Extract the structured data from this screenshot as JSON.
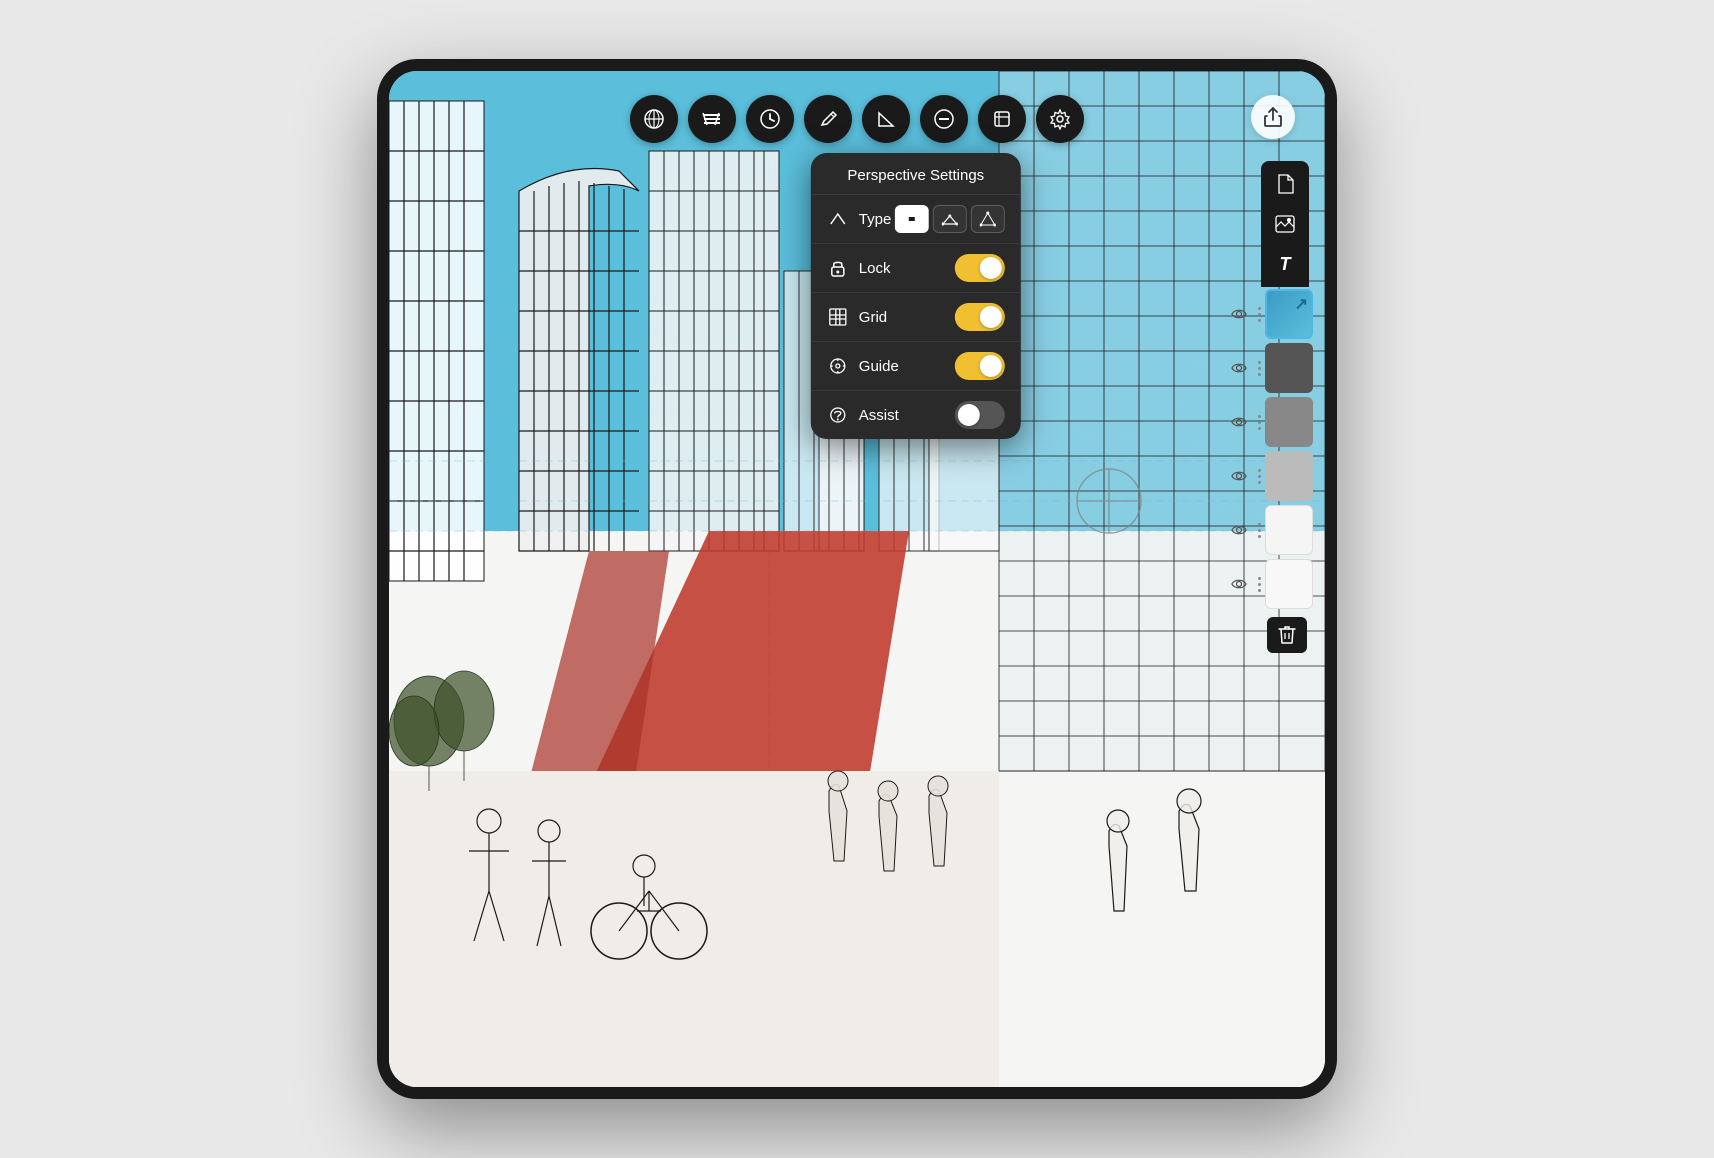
{
  "device": {
    "frame_bg": "#1a1a1a",
    "screen_bg": "#ffffff"
  },
  "toolbar": {
    "tools": [
      {
        "id": "perspective",
        "label": "Perspective Tool",
        "icon": "⊕",
        "active": false
      },
      {
        "id": "grid-lines",
        "label": "Grid Lines",
        "icon": "≡≡",
        "active": false
      },
      {
        "id": "clock",
        "label": "Clock",
        "icon": "◷",
        "active": false
      },
      {
        "id": "pencil",
        "label": "Pencil",
        "icon": "/",
        "active": false
      },
      {
        "id": "angle",
        "label": "Angle",
        "icon": "△",
        "active": false
      },
      {
        "id": "minus-circle",
        "label": "Remove",
        "icon": "⊖",
        "active": false
      },
      {
        "id": "import",
        "label": "Import",
        "icon": "⊞",
        "active": false
      },
      {
        "id": "settings",
        "label": "Settings",
        "icon": "⚙",
        "active": true
      }
    ],
    "share_label": "Share"
  },
  "perspective_panel": {
    "title": "Perspective Settings",
    "rows": [
      {
        "id": "type",
        "icon": "perspective-icon",
        "label": "Type",
        "control": "type-selector",
        "types": [
          {
            "id": "1point",
            "icon": "1pt",
            "selected": true
          },
          {
            "id": "2point",
            "icon": "2pt",
            "selected": false
          },
          {
            "id": "3point",
            "icon": "3pt",
            "selected": false
          }
        ]
      },
      {
        "id": "lock",
        "icon": "lock-icon",
        "label": "Lock",
        "control": "toggle",
        "value": true
      },
      {
        "id": "grid",
        "icon": "grid-icon",
        "label": "Grid",
        "control": "toggle",
        "value": true
      },
      {
        "id": "guide",
        "icon": "guide-icon",
        "label": "Guide",
        "control": "toggle",
        "value": true
      },
      {
        "id": "assist",
        "icon": "assist-icon",
        "label": "Assist",
        "control": "toggle",
        "value": false
      }
    ]
  },
  "layers_panel": {
    "layers": [
      {
        "id": 1,
        "visible": true,
        "color": "blue",
        "thumb_type": "blue-layer"
      },
      {
        "id": 2,
        "visible": true,
        "color": "gray-dark",
        "thumb_type": "gray-dark"
      },
      {
        "id": 3,
        "visible": true,
        "color": "gray-mid",
        "thumb_type": "gray-mid"
      },
      {
        "id": 4,
        "visible": true,
        "color": "gray-light",
        "thumb_type": "gray-light"
      },
      {
        "id": 5,
        "visible": true,
        "color": "white",
        "thumb_type": "white"
      },
      {
        "id": 6,
        "visible": true,
        "color": "white",
        "thumb_type": "white"
      }
    ]
  },
  "icons": {
    "tools": [
      "⊕",
      "▦",
      "◷",
      "✏",
      "⊿",
      "⊖",
      "⊞",
      "⚙"
    ],
    "layer_icons": [
      "📄",
      "🖼",
      "T",
      "↗"
    ],
    "share": "⬆",
    "eye": "👁",
    "ellipsis": "•••",
    "trash": "🗑"
  },
  "colors": {
    "sky_blue": "#5bbfdc",
    "dark_bg": "#2a2a2a",
    "toggle_on": "#f0c030",
    "toggle_off": "#555555",
    "red_walkway": "#c0392b",
    "panel_text": "#ffffff"
  }
}
